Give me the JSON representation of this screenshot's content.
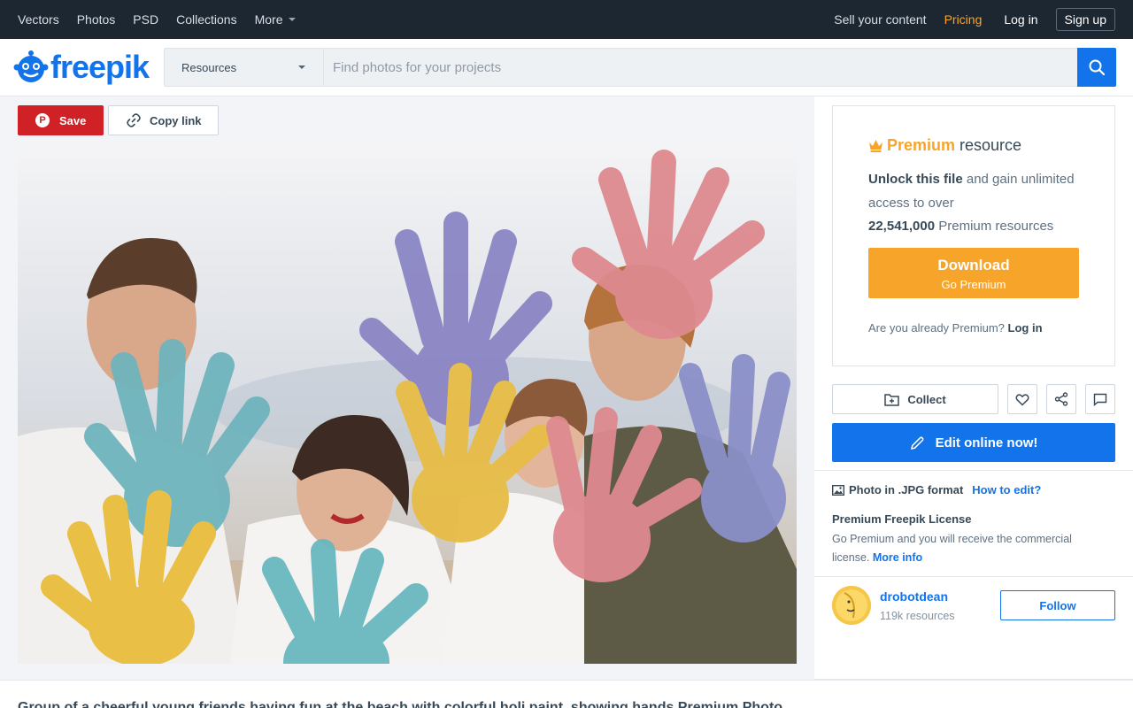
{
  "topnav": {
    "left": [
      "Vectors",
      "Photos",
      "PSD",
      "Collections",
      "More"
    ],
    "sell": "Sell your content",
    "pricing": "Pricing",
    "login": "Log in",
    "signup": "Sign up"
  },
  "header": {
    "logo": "freepik",
    "search_category": "Resources",
    "search_placeholder": "Find photos for your projects"
  },
  "actions": {
    "save": "Save",
    "copy_link": "Copy link"
  },
  "premium": {
    "title_highlight": "Premium",
    "title_rest": "resource",
    "unlock_bold": "Unlock this file",
    "unlock_rest": "and gain unlimited access to over",
    "count": "22,541,000",
    "count_rest": "Premium resources",
    "download": "Download",
    "download_sub": "Go Premium",
    "already": "Are you already Premium?",
    "login": "Log in"
  },
  "tools": {
    "collect": "Collect",
    "edit_online": "Edit online now!"
  },
  "file": {
    "format": "Photo in .JPG format",
    "how_to_edit": "How to edit?",
    "license_title": "Premium Freepik License",
    "license_text": "Go Premium and you will receive the commercial license.",
    "more_info": "More info"
  },
  "author": {
    "name": "drobotdean",
    "resources": "119k resources",
    "follow": "Follow"
  },
  "caption": "Group of a cheerful young friends having fun at the beach with colorful holi paint, showing hands Premium Photo",
  "colors": {
    "brand_blue": "#1273eb",
    "premium_orange": "#f7a52a",
    "pinterest_red": "#d02126",
    "nav_bg": "#1d2732"
  }
}
